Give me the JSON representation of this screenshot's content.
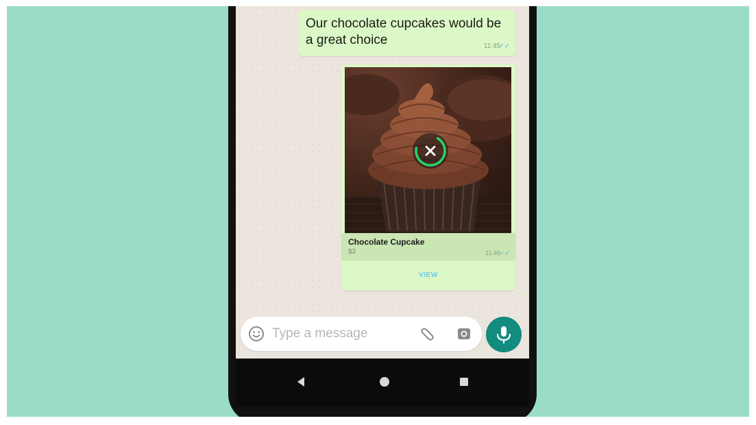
{
  "chat": {
    "outgoing_message": {
      "text": "Our chocolate cupcakes would be a great choice",
      "time": "11:45"
    },
    "product_message": {
      "product_name": "Chocolate Cupcake",
      "price": "$3",
      "time": "11:46",
      "view_label": "VIEW",
      "image_icon": "cupcake-photo",
      "download_state": "downloading"
    }
  },
  "composer": {
    "placeholder": "Type a message",
    "emoji_icon": "emoji-icon",
    "attach_icon": "paperclip-icon",
    "camera_icon": "camera-icon",
    "mic_icon": "mic-icon"
  },
  "navigation": {
    "back_icon": "back-triangle-icon",
    "home_icon": "home-circle-icon",
    "recent_icon": "recent-square-icon"
  },
  "colors": {
    "background": "#9bdcc9",
    "chat_wallpaper": "#ece5dd",
    "outgoing_bubble": "#dcf8c6",
    "accent_green": "#128c7e",
    "progress_green": "#25d366",
    "link_blue": "#34b7f1"
  }
}
